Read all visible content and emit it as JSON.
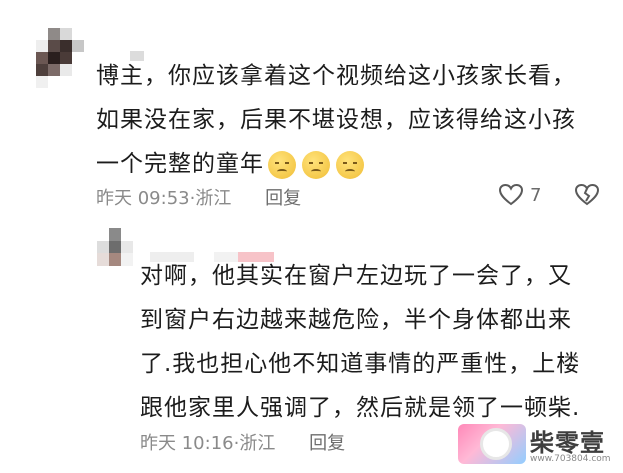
{
  "comment": {
    "text_lines": [
      "博主，你应该拿着这个视频给这小孩家长看，",
      "如果没在家，后果不堪设想，应该得给这小孩",
      "一个完整的童年"
    ],
    "emoji_icons": [
      "worried-face-icon",
      "worried-face-icon",
      "worried-face-icon"
    ],
    "time": "昨天 09:53",
    "location": "浙江",
    "reply_label": "回复",
    "like_count": "7"
  },
  "reply": {
    "text_lines": [
      "对啊，他其实在窗户左边玩了一会了，又",
      "到窗户右边越来越危险，半个身体都出来",
      "了.我也担心他不知道事情的严重性，上楼",
      "跟他家里人强调了，然后就是领了一顿柴."
    ],
    "time": "昨天 10:16",
    "location": "浙江",
    "reply_label": "回复"
  },
  "watermark": {
    "brand": "柴零壹",
    "url": "www.703804.com"
  },
  "colors": {
    "text": "#1c1c1c",
    "meta": "#8a8a8a",
    "emoji": "#f5c94b"
  }
}
